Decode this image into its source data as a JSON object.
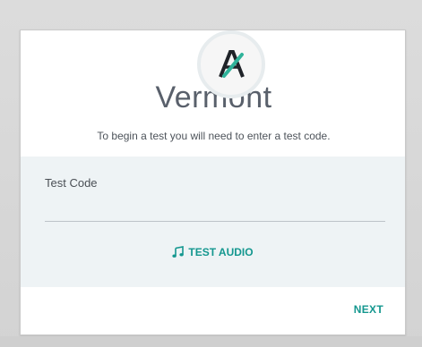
{
  "app": {
    "title": "Vermont",
    "subtitle": "To begin a test you will need to enter a test code."
  },
  "form": {
    "code_label": "Test Code",
    "code_value": "",
    "code_placeholder": ""
  },
  "actions": {
    "test_audio_label": "TEST AUDIO",
    "next_label": "NEXT"
  },
  "icons": {
    "logo": "a-logo-icon",
    "audio": "music-note-icon"
  },
  "colors": {
    "accent": "#14978f",
    "title": "#59606b",
    "form_bg": "#eef3f5"
  }
}
